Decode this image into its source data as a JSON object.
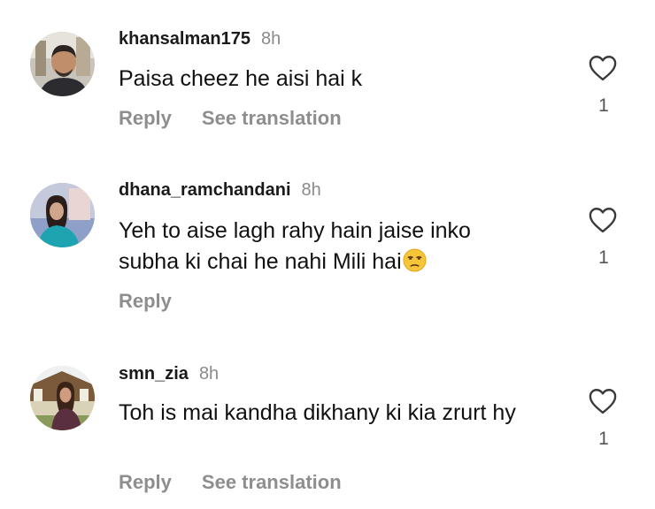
{
  "comments": [
    {
      "username": "khansalman175",
      "time": "8h",
      "text": "Paisa cheez he aisi hai k",
      "reply_label": "Reply",
      "translate_label": "See translation",
      "likes": "1",
      "emoji": ""
    },
    {
      "username": "dhana_ramchandani",
      "time": "8h",
      "text": "Yeh to aise lagh rahy hain jaise inko subha ki chai he nahi Mili hai",
      "reply_label": "Reply",
      "likes": "1",
      "emoji": "unamused-face-emoji"
    },
    {
      "username": "smn_zia",
      "time": "8h",
      "text": "Toh is mai kandha dikhany ki kia zrurt hy",
      "reply_label": "Reply",
      "translate_label": "See translation",
      "likes": "1",
      "emoji": ""
    }
  ],
  "icons": {
    "like": "heart-outline-icon"
  },
  "colors": {
    "secondary_text": "#8e8e8e",
    "primary_text": "#111111"
  }
}
